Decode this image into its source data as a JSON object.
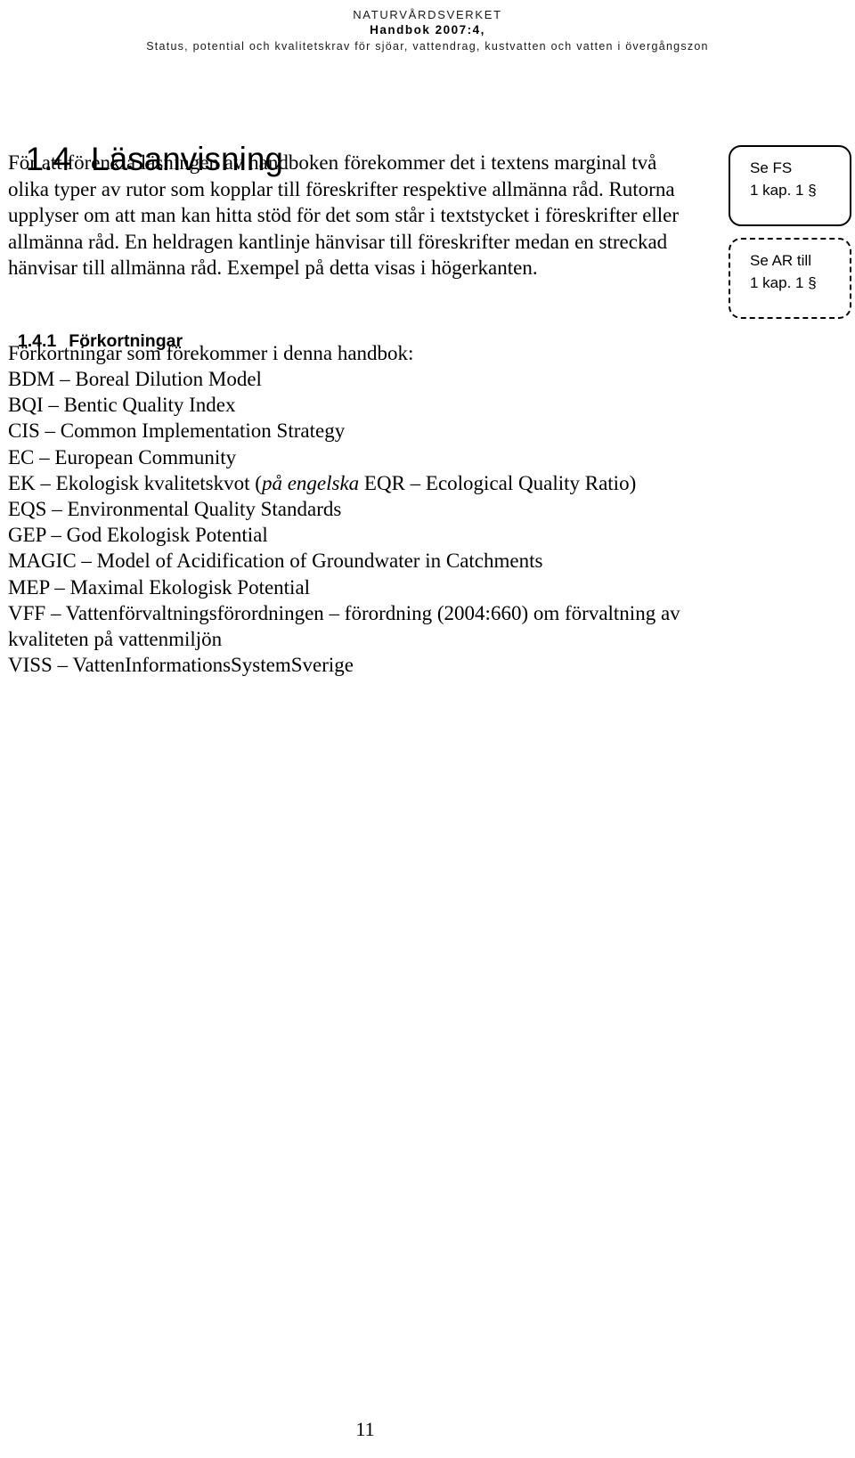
{
  "header": {
    "organisation": "NATURVÅRDSVERKET",
    "publication": "Handbok 2007:4,",
    "subtitle": "Status, potential och kvalitetskrav för sjöar, vattendrag, kustvatten och vatten i övergångszon"
  },
  "section": {
    "number": "1.4",
    "title": "Läsanvisning",
    "paragraph_lines": [
      "För att förenkla läsningen av handboken förekommer det i textens marginal två",
      "olika typer av rutor som kopplar till föreskrifter respektive allmänna råd. Rutorna",
      "upplyser om att man kan hitta stöd för det som står i textstycket i föreskrifter eller",
      "allmänna råd. En heldragen kantlinje hänvisar till föreskrifter medan en streckad",
      "hänvisar till allmänna råd. Exempel på detta visas i högerkanten."
    ]
  },
  "subsection": {
    "number": "1.4.1",
    "title": "Förkortningar",
    "intro": "Förkortningar som förekommer i denna handbok:",
    "abbreviations": [
      {
        "abbr": "BDM",
        "dash": "–",
        "expansion": "Boreal Dilution Model"
      },
      {
        "abbr": "BQI",
        "dash": "–",
        "expansion": "Bentic Quality Index"
      },
      {
        "abbr": "CIS",
        "dash": "–",
        "expansion": "Common Implementation Strategy"
      },
      {
        "abbr": "EC",
        "dash": "–",
        "expansion": "European Community"
      },
      {
        "abbr": "EK",
        "dash": "–",
        "expansion_pre": "Ekologisk kvalitetskvot (",
        "expansion_italic": "på engelska",
        "expansion_post": " EQR – Ecological Quality Ratio)"
      },
      {
        "abbr": "EQS",
        "dash": "–",
        "expansion": "Environmental Quality Standards"
      },
      {
        "abbr": "GEP",
        "dash": "–",
        "expansion": "God Ekologisk Potential"
      },
      {
        "abbr": "MAGIC",
        "dash": "–",
        "expansion": "Model of Acidification of Groundwater in Catchments"
      },
      {
        "abbr": "MEP",
        "dash": "–",
        "expansion": "Maximal Ekologisk Potential"
      },
      {
        "abbr": "VFF",
        "dash": "–",
        "expansion": "Vattenförvaltningsförordningen – förordning (2004:660) om förvaltning av",
        "continuation": "kvaliteten på vattenmiljön"
      },
      {
        "abbr": "VISS",
        "dash": "–",
        "expansion": "VattenInformationsSystemSverige"
      }
    ]
  },
  "margin_notes": [
    {
      "style": "solid",
      "line1": "Se FS",
      "line2": "1 kap. 1 §"
    },
    {
      "style": "dashed",
      "line1": "Se AR till",
      "line2": "1 kap. 1 §"
    }
  ],
  "footer": {
    "page_number": "11"
  },
  "colors": {
    "text": "#000000",
    "background": "#ffffff",
    "border": "#000000"
  }
}
